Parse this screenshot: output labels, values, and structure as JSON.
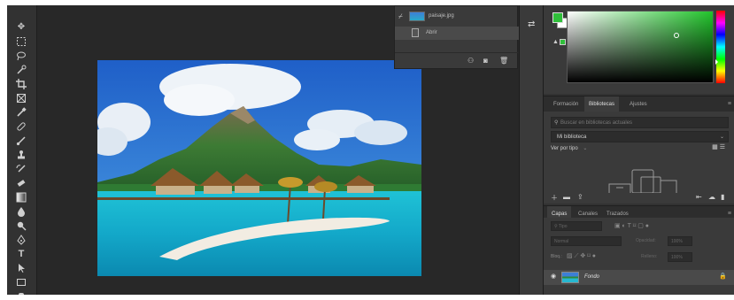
{
  "toolbar": {
    "tools": [
      "move-tool",
      "marquee-tool",
      "lasso-tool",
      "quick-select-tool",
      "crop-tool",
      "frame-tool",
      "eyedropper-tool",
      "healing-brush-tool",
      "brush-tool",
      "clone-stamp-tool",
      "history-brush-tool",
      "eraser-tool",
      "gradient-tool",
      "blur-tool",
      "dodge-tool",
      "pen-tool",
      "type-tool",
      "path-select-tool",
      "rectangle-tool",
      "hand-tool"
    ]
  },
  "history": {
    "items": [
      {
        "label": "paisaje.jpg"
      },
      {
        "label": "Abrir"
      }
    ],
    "buttons": {
      "new_snapshot": "⚇",
      "camera": "◙",
      "trash": "🗑"
    }
  },
  "color": {
    "foreground": "#2fbf3a",
    "background": "#ffffff",
    "picker_hue": "#21c42b"
  },
  "library_tabs": {
    "tabs": [
      "Formación",
      "Bibliotecas",
      "Ajustes"
    ],
    "active": "Bibliotecas"
  },
  "libraries": {
    "search_placeholder": "Buscar en bibliotecas actuales",
    "library_name": "Mi biblioteca",
    "view_label": "Ver por tipo"
  },
  "layers_tabs": {
    "tabs": [
      "Capas",
      "Canales",
      "Trazados"
    ],
    "active": "Capas"
  },
  "layers": {
    "filter": "Tipo",
    "blend_mode": "Normal",
    "opacity_label": "Opacidad:",
    "opacity_value": "100%",
    "lock_label": "Bloq.:",
    "fill_label": "Relleno:",
    "fill_value": "100%",
    "layer_name": "Fondo"
  }
}
